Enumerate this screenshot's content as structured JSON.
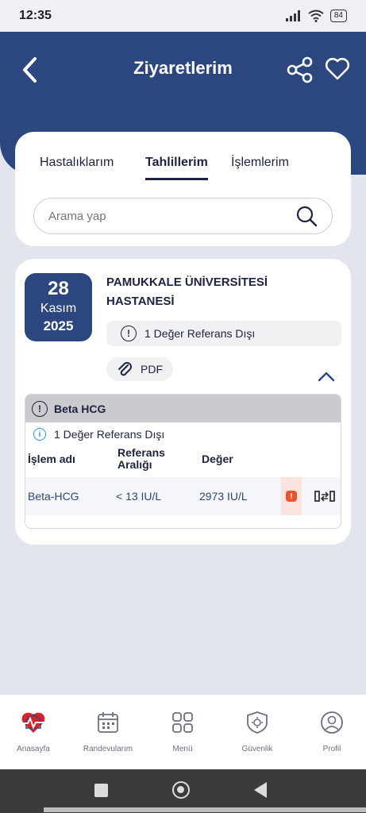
{
  "status_bar": {
    "time": "12:35",
    "battery": "84"
  },
  "header": {
    "title": "Ziyaretlerim"
  },
  "tabs": [
    {
      "label": "Hastalıklarım",
      "active": false
    },
    {
      "label": "Tahlillerim",
      "active": true
    },
    {
      "label": "İşlemlerim",
      "active": false
    }
  ],
  "search": {
    "placeholder": "Arama yap"
  },
  "visit": {
    "day": "28",
    "month": "Kasım",
    "year": "2025",
    "hospital": "PAMUKKALE ÜNİVERSİTESİ HASTANESİ",
    "warning": "1 Değer Referans Dışı",
    "pdf_label": "PDF",
    "test": {
      "name": "Beta HCG",
      "info": "1 Değer Referans Dışı",
      "columns": {
        "name": "İşlem adı",
        "reference_line1": "Referans",
        "reference_line2": "Aralığı",
        "value": "Değer"
      },
      "rows": [
        {
          "name": "Beta-HCG",
          "reference": "< 13 IU/L",
          "value": "2973 IU/L"
        }
      ]
    }
  },
  "nav": [
    {
      "label": "Anasayfa",
      "icon": "home-heart-icon"
    },
    {
      "label": "Randevularım",
      "icon": "calendar-icon"
    },
    {
      "label": "Menü",
      "icon": "grid-icon"
    },
    {
      "label": "Güvenlik",
      "icon": "shield-gear-icon"
    },
    {
      "label": "Profil",
      "icon": "user-icon"
    }
  ],
  "colors": {
    "primary": "#2c4680",
    "alert": "#e8542c",
    "info": "#2a9bd6"
  }
}
